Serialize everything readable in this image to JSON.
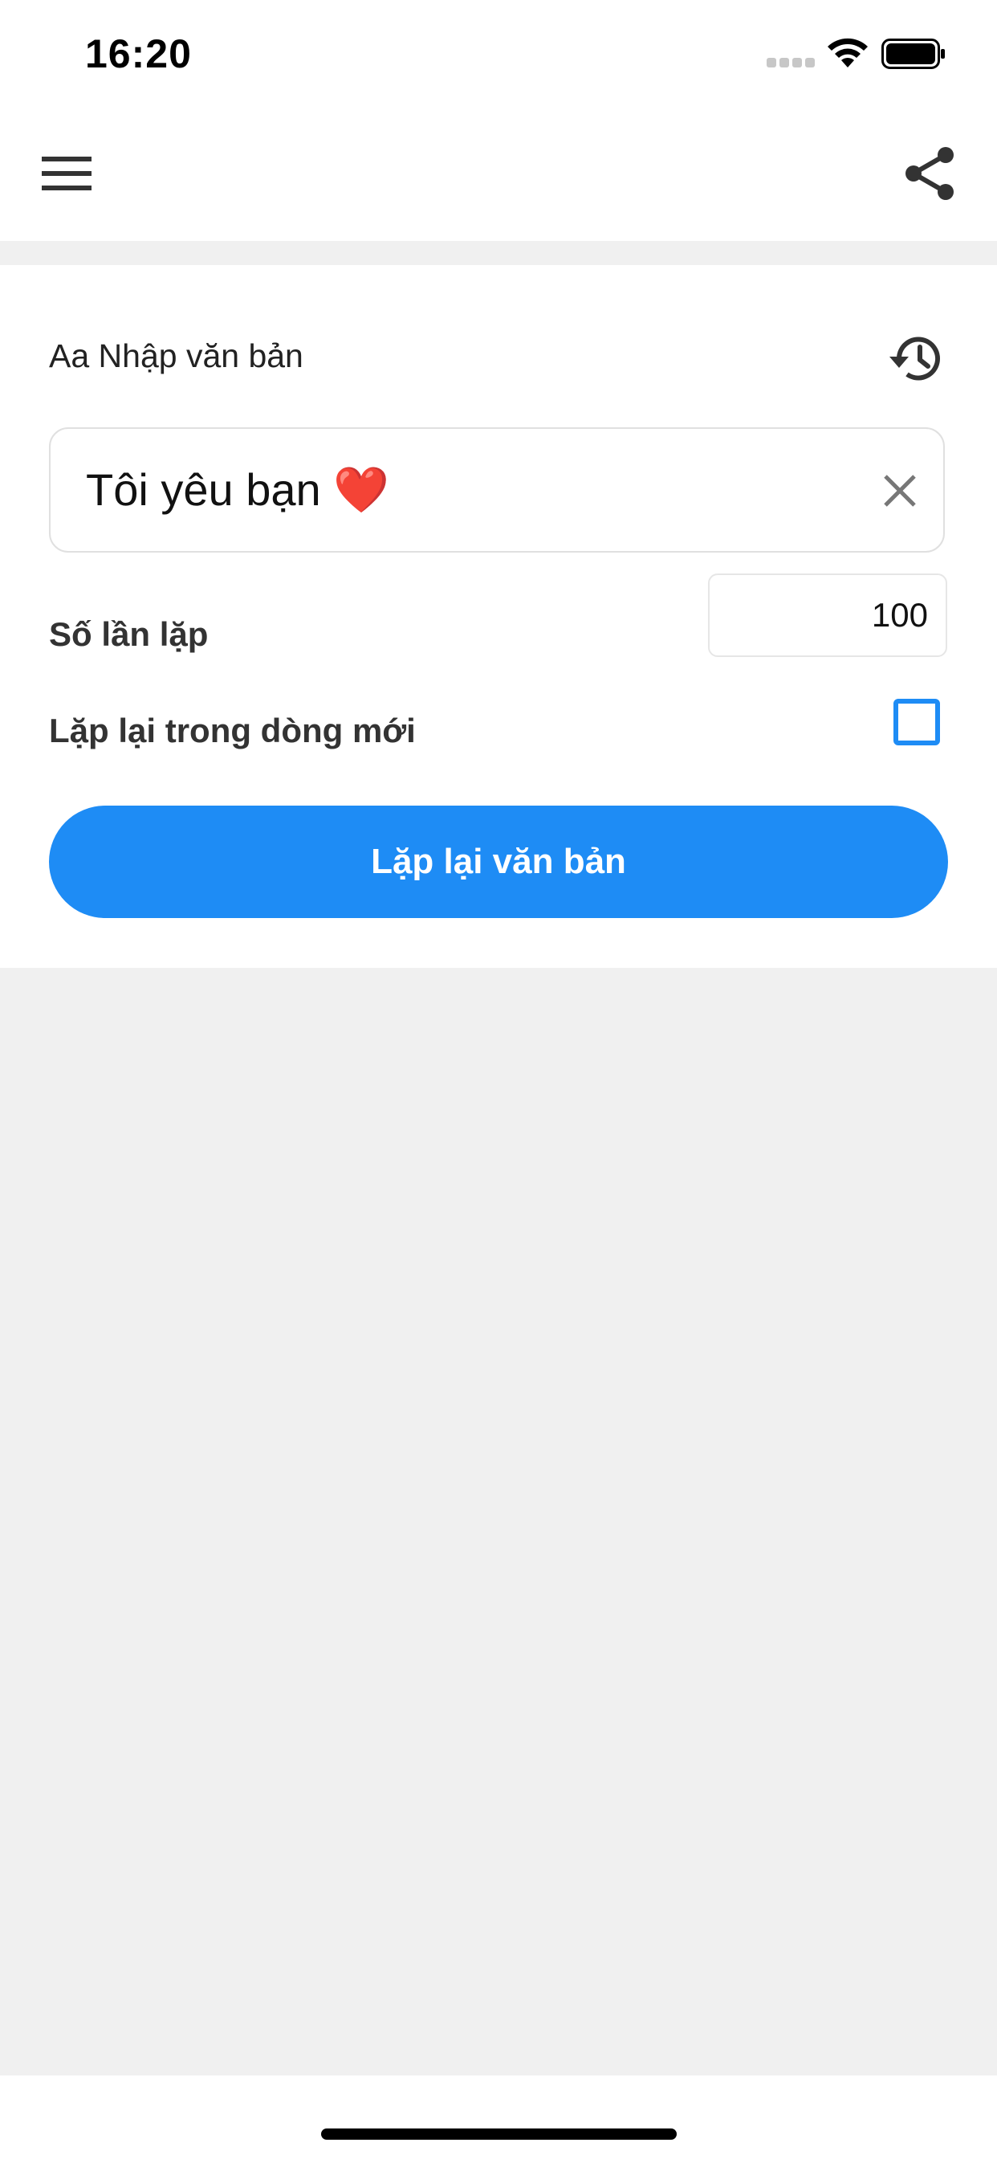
{
  "status_bar": {
    "time": "16:20"
  },
  "app_bar": {
    "menu_icon": "menu-icon",
    "share_icon": "share-icon"
  },
  "form": {
    "input_label": "Aa Nhập văn bản",
    "history_icon": "history-icon",
    "text_value": "Tôi yêu bạn ❤️",
    "clear_icon": "close-icon",
    "repeat_count_label": "Số lần lặp",
    "repeat_count_value": "100",
    "new_line_label": "Lặp lại trong dòng mới",
    "new_line_checked": false,
    "submit_label": "Lặp lại văn bản"
  },
  "colors": {
    "accent": "#1e8cf5",
    "background": "#f0f0f0",
    "surface": "#ffffff"
  }
}
